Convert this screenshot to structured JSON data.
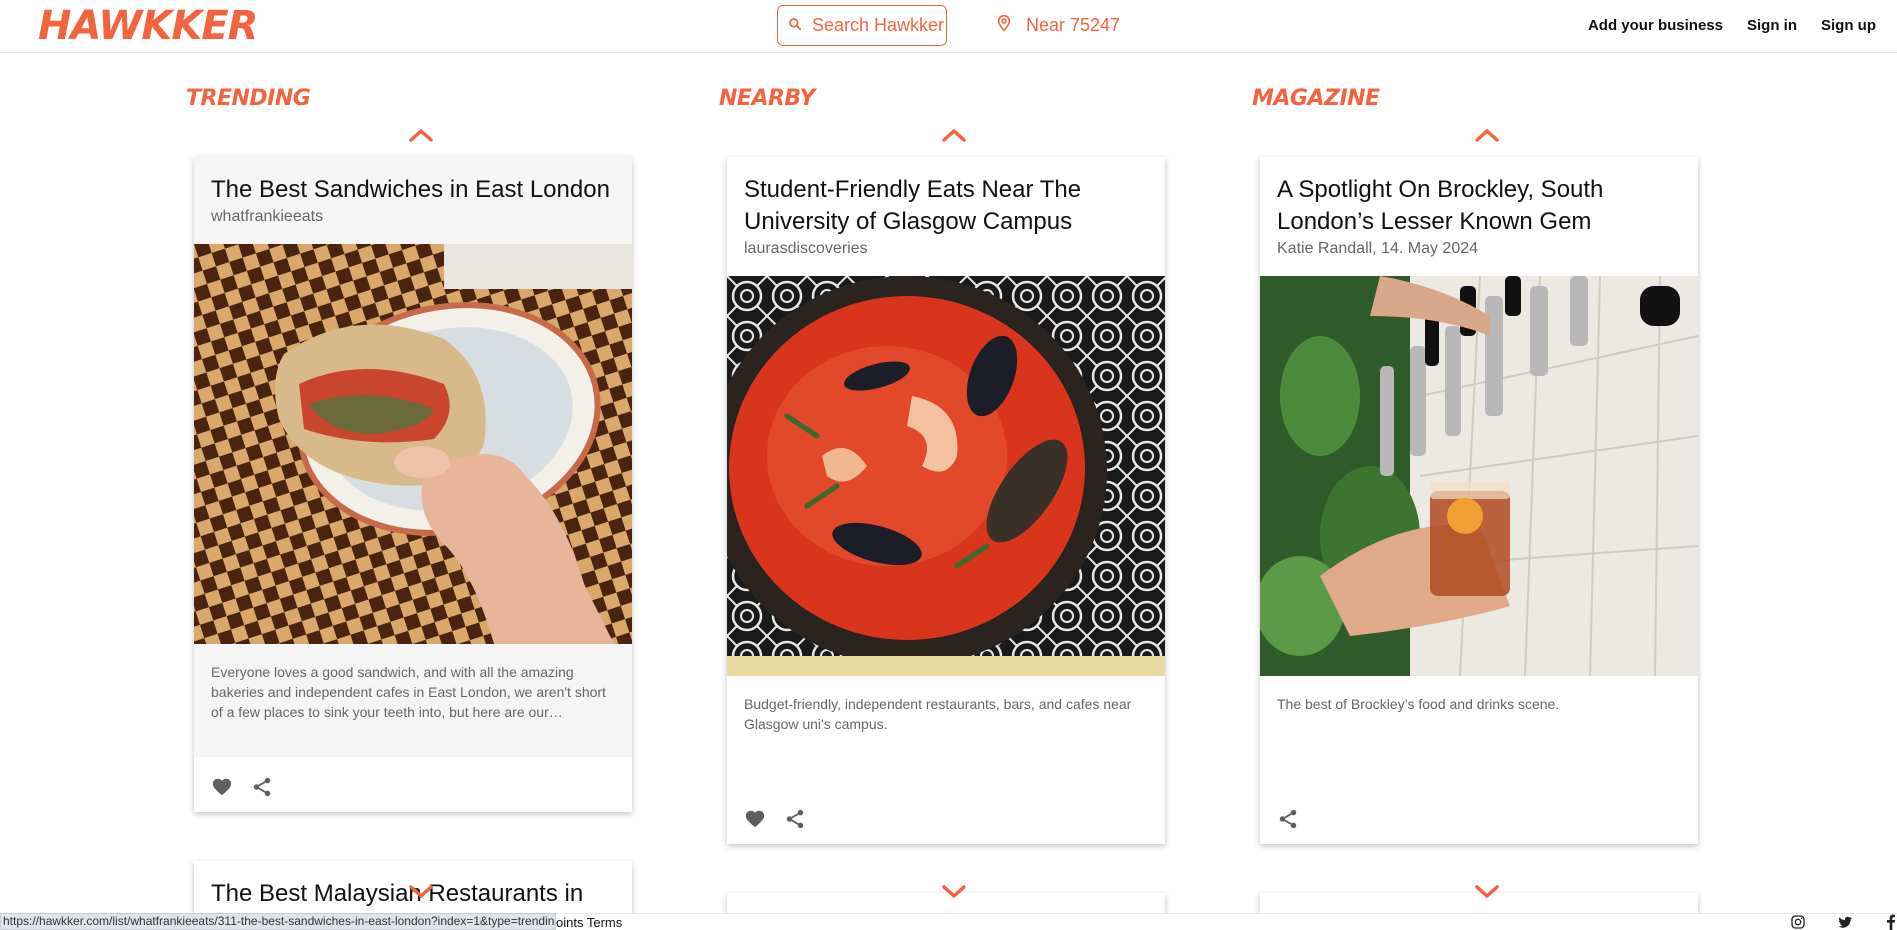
{
  "header": {
    "logo": "HAWKKER",
    "search_placeholder": "Search Hawkker",
    "location": "Near 75247",
    "nav": [
      "Add your business",
      "Sign in",
      "Sign up"
    ]
  },
  "columns": [
    {
      "heading": "TRENDING",
      "card": {
        "title": "The Best Sandwiches in East London",
        "subtitle": "whatfrankieeats",
        "description": "Everyone loves a good sandwich, and with all the amazing bakeries and independent cafes in East London, we aren't short of a few places to sink your teeth into, but here are our…",
        "actions": [
          "heart-icon",
          "share-icon"
        ]
      },
      "next_card_title": "The Best Malaysian Restaurants in"
    },
    {
      "heading": "NEARBY",
      "card": {
        "title": "Student-Friendly Eats Near The University of Glasgow Campus",
        "subtitle": "laurasdiscoveries",
        "description": "Budget-friendly, independent restaurants, bars, and cafes near Glasgow uni's campus.",
        "actions": [
          "heart-icon",
          "share-icon"
        ]
      }
    },
    {
      "heading": "MAGAZINE",
      "card": {
        "title": "A Spotlight On Brockley, South London’s Lesser Known Gem",
        "subtitle": "Katie Randall, 14. May 2024",
        "description": "The best of Brockley’s food and drinks scene.",
        "actions": [
          "share-icon"
        ]
      }
    }
  ],
  "footer": {
    "status_url": "https://hawkker.com/list/whatfrankieeats/311-the-best-sandwiches-in-east-london?index=1&type=trending",
    "links": "oints Terms",
    "social": [
      "instagram-icon",
      "twitter-icon",
      "facebook-icon"
    ]
  },
  "colors": {
    "accent": "#f26440",
    "text": "#111111",
    "muted": "#666666",
    "card_grey": "#f5f5f5"
  }
}
